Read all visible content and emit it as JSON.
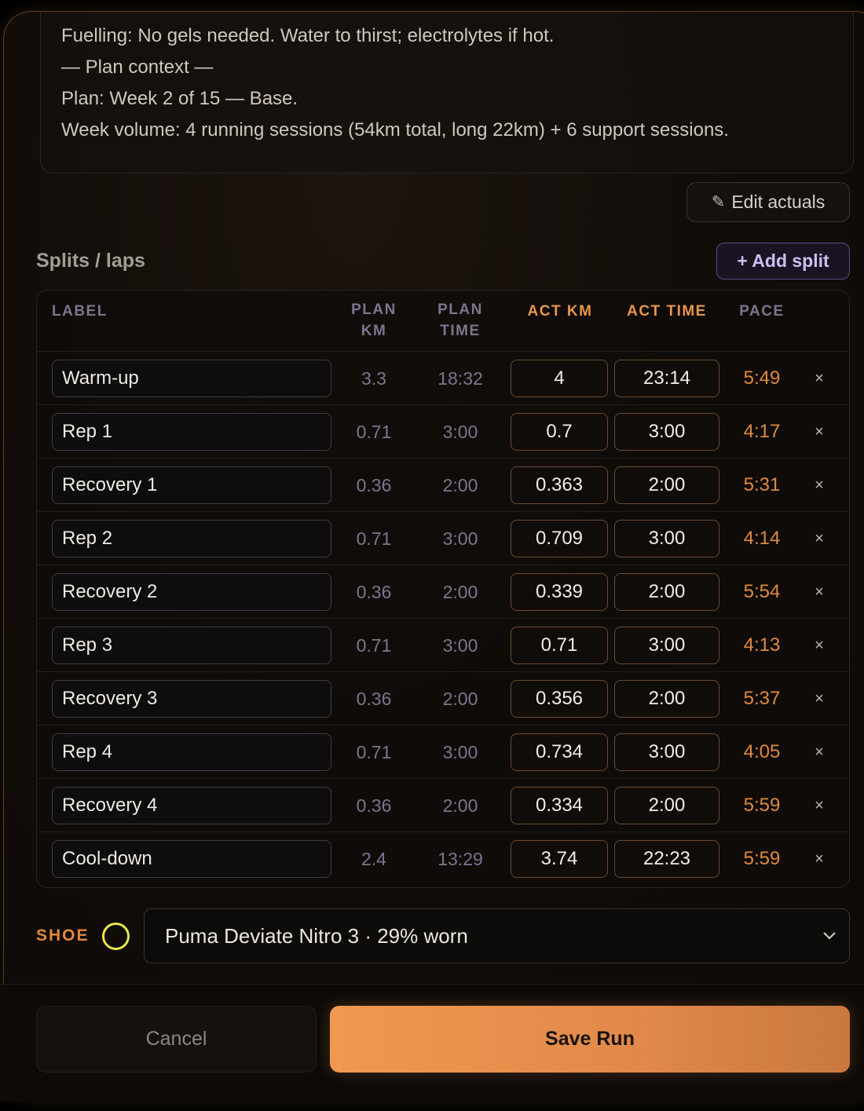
{
  "notes": {
    "lines": [
      "Fuelling: No gels needed. Water to thirst; electrolytes if hot.",
      "— Plan context —",
      "Plan: Week 2 of 15 — Base.",
      "Week volume: 4 running sessions (54km total, long 22km) + 6 support sessions."
    ]
  },
  "edit_actuals": {
    "icon": "pencil-icon",
    "label": "Edit actuals"
  },
  "splits": {
    "title": "Splits / laps",
    "add_label": "+ Add split",
    "headers": {
      "label": "LABEL",
      "plan_km": "PLAN\nKM",
      "plan_time": "PLAN\nTIME",
      "act_km": "ACT KM",
      "act_time": "ACT TIME",
      "pace": "PACE"
    },
    "rows": [
      {
        "label": "Warm-up",
        "plan_km": "3.3",
        "plan_time": "18:32",
        "act_km": "4",
        "act_time": "23:14",
        "pace": "5:49"
      },
      {
        "label": "Rep 1",
        "plan_km": "0.71",
        "plan_time": "3:00",
        "act_km": "0.7",
        "act_time": "3:00",
        "pace": "4:17"
      },
      {
        "label": "Recovery 1",
        "plan_km": "0.36",
        "plan_time": "2:00",
        "act_km": "0.363",
        "act_time": "2:00",
        "pace": "5:31"
      },
      {
        "label": "Rep 2",
        "plan_km": "0.71",
        "plan_time": "3:00",
        "act_km": "0.709",
        "act_time": "3:00",
        "pace": "4:14"
      },
      {
        "label": "Recovery 2",
        "plan_km": "0.36",
        "plan_time": "2:00",
        "act_km": "0.339",
        "act_time": "2:00",
        "pace": "5:54"
      },
      {
        "label": "Rep 3",
        "plan_km": "0.71",
        "plan_time": "3:00",
        "act_km": "0.71",
        "act_time": "3:00",
        "pace": "4:13"
      },
      {
        "label": "Recovery 3",
        "plan_km": "0.36",
        "plan_time": "2:00",
        "act_km": "0.356",
        "act_time": "2:00",
        "pace": "5:37"
      },
      {
        "label": "Rep 4",
        "plan_km": "0.71",
        "plan_time": "3:00",
        "act_km": "0.734",
        "act_time": "3:00",
        "pace": "4:05"
      },
      {
        "label": "Recovery 4",
        "plan_km": "0.36",
        "plan_time": "2:00",
        "act_km": "0.334",
        "act_time": "2:00",
        "pace": "5:59"
      },
      {
        "label": "Cool-down",
        "plan_km": "2.4",
        "plan_time": "13:29",
        "act_km": "3.74",
        "act_time": "22:23",
        "pace": "5:59"
      }
    ],
    "delete_glyph": "×"
  },
  "shoe": {
    "label": "SHOE",
    "selected": "Puma Deviate Nitro 3 · 29% worn",
    "ring_color": "#e8e64a"
  },
  "footer": {
    "cancel_label": "Cancel",
    "save_label": "Save Run"
  },
  "colors": {
    "accent": "#e08a3c",
    "save_gradient_start": "#f09850",
    "add_split_accent": "#cdbdf2"
  }
}
